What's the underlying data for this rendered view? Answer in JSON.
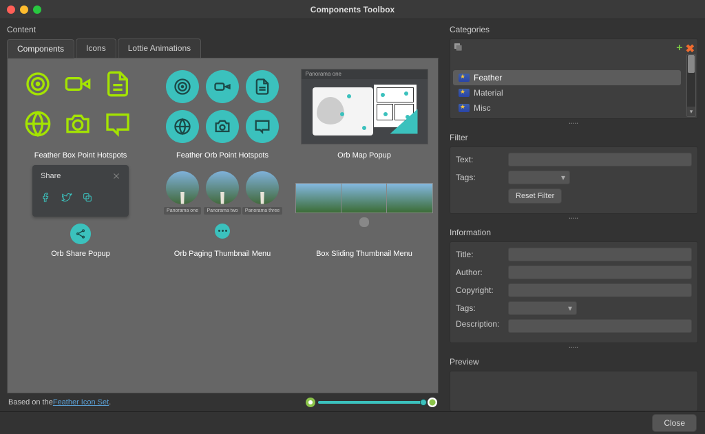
{
  "window": {
    "title": "Components Toolbox"
  },
  "left": {
    "label": "Content",
    "tabs": [
      "Components",
      "Icons",
      "Lottie Animations"
    ],
    "cards": [
      {
        "label": "Feather Box Point Hotspots"
      },
      {
        "label": "Feather Orb Point Hotspots"
      },
      {
        "label": "Orb Map Popup"
      },
      {
        "label": "Orb Share Popup"
      },
      {
        "label": "Orb Paging Thumbnail Menu"
      },
      {
        "label": "Box Sliding Thumbnail Menu"
      }
    ],
    "share_card": {
      "title": "Share"
    },
    "map_card": {
      "title": "Panorama one"
    },
    "paging": {
      "items": [
        "Panorama one",
        "Panorama two",
        "Panorama three"
      ]
    },
    "footer": {
      "prefix": "Based on the ",
      "link": "Feather Icon Set",
      "suffix": "."
    }
  },
  "right": {
    "categories_label": "Categories",
    "categories": [
      "Feather",
      "Material",
      "Misc"
    ],
    "filter": {
      "label": "Filter",
      "text_label": "Text:",
      "tags_label": "Tags:",
      "reset": "Reset Filter"
    },
    "info": {
      "label": "Information",
      "title_label": "Title:",
      "author_label": "Author:",
      "copyright_label": "Copyright:",
      "tags_label": "Tags:",
      "desc_label": "Description:"
    },
    "preview_label": "Preview"
  },
  "bottom": {
    "close": "Close"
  }
}
